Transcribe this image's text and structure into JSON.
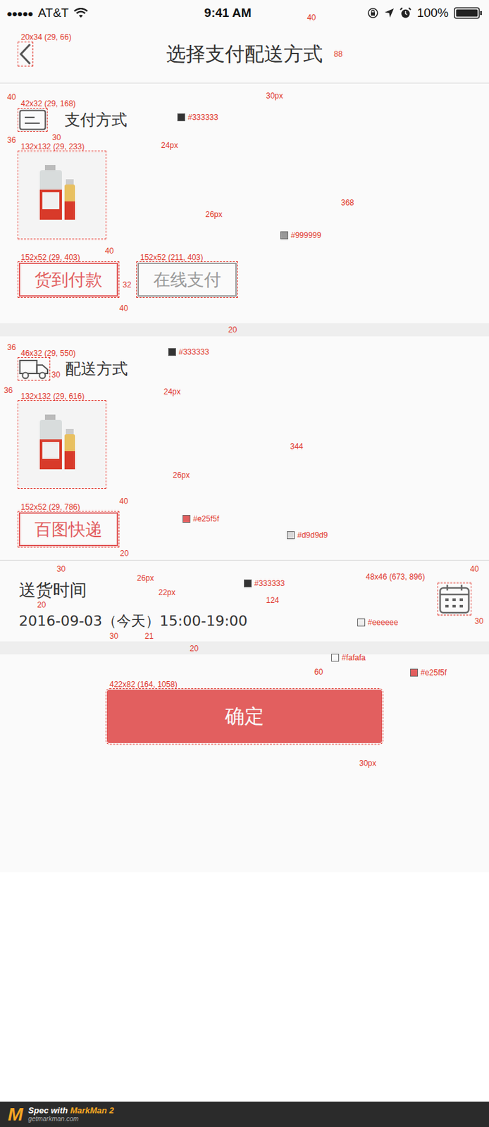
{
  "status_bar": {
    "signal": "●●●●●",
    "carrier": "AT&T",
    "time": "9:41 AM",
    "battery": "100%"
  },
  "nav": {
    "title": "选择支付配送方式"
  },
  "payment": {
    "title": "支付方式",
    "options": [
      {
        "label": "货到付款",
        "selected": true
      },
      {
        "label": "在线支付",
        "selected": false
      }
    ]
  },
  "delivery": {
    "title": "配送方式",
    "options": [
      {
        "label": "百图快递",
        "selected": true
      }
    ]
  },
  "delivery_time": {
    "title": "送货时间",
    "value": "2016-09-03（今天）15:00-19:00"
  },
  "confirm_button": "确定",
  "annotations": [
    {
      "text": "40",
      "kind": "measure"
    },
    {
      "text": "20x34 (29, 66)",
      "kind": "measure"
    },
    {
      "text": "88",
      "kind": "measure"
    },
    {
      "text": "30px",
      "kind": "measure"
    },
    {
      "text": "40",
      "kind": "measure"
    },
    {
      "text": "42x32 (29, 168)",
      "kind": "measure"
    },
    {
      "text": "#333333",
      "kind": "color",
      "color": "#333333"
    },
    {
      "text": "30",
      "kind": "measure"
    },
    {
      "text": "36",
      "kind": "measure"
    },
    {
      "text": "24px",
      "kind": "measure"
    },
    {
      "text": "132x132 (29, 233)",
      "kind": "measure"
    },
    {
      "text": "368",
      "kind": "measure"
    },
    {
      "text": "26px",
      "kind": "measure"
    },
    {
      "text": "#999999",
      "kind": "color",
      "color": "#999999"
    },
    {
      "text": "40",
      "kind": "measure"
    },
    {
      "text": "152x52 (29, 403)",
      "kind": "measure"
    },
    {
      "text": "152x52 (211, 403)",
      "kind": "measure"
    },
    {
      "text": "32",
      "kind": "measure"
    },
    {
      "text": "40",
      "kind": "measure"
    },
    {
      "text": "20",
      "kind": "measure"
    },
    {
      "text": "36",
      "kind": "measure"
    },
    {
      "text": "46x32 (29, 550)",
      "kind": "measure"
    },
    {
      "text": "#333333",
      "kind": "color",
      "color": "#333333"
    },
    {
      "text": "30",
      "kind": "measure"
    },
    {
      "text": "24px",
      "kind": "measure"
    },
    {
      "text": "36",
      "kind": "measure"
    },
    {
      "text": "132x132 (29, 616)",
      "kind": "measure"
    },
    {
      "text": "344",
      "kind": "measure"
    },
    {
      "text": "26px",
      "kind": "measure"
    },
    {
      "text": "40",
      "kind": "measure"
    },
    {
      "text": "152x52 (29, 786)",
      "kind": "measure"
    },
    {
      "text": "#e25f5f",
      "kind": "color",
      "color": "#e25f5f"
    },
    {
      "text": "#d9d9d9",
      "kind": "color",
      "color": "#d9d9d9"
    },
    {
      "text": "20",
      "kind": "measure"
    },
    {
      "text": "30",
      "kind": "measure"
    },
    {
      "text": "48x46 (673, 896)",
      "kind": "measure"
    },
    {
      "text": "40",
      "kind": "measure"
    },
    {
      "text": "26px",
      "kind": "measure"
    },
    {
      "text": "#333333",
      "kind": "color",
      "color": "#333333"
    },
    {
      "text": "22px",
      "kind": "measure"
    },
    {
      "text": "124",
      "kind": "measure"
    },
    {
      "text": "20",
      "kind": "measure"
    },
    {
      "text": "21",
      "kind": "measure"
    },
    {
      "text": "30",
      "kind": "measure"
    },
    {
      "text": "30",
      "kind": "measure"
    },
    {
      "text": "#eeeeee",
      "kind": "color",
      "color": "#eeeeee"
    },
    {
      "text": "20",
      "kind": "measure"
    },
    {
      "text": "#fafafa",
      "kind": "color",
      "color": "#fafafa"
    },
    {
      "text": "60",
      "kind": "measure"
    },
    {
      "text": "#e25f5f",
      "kind": "color",
      "color": "#e25f5f"
    },
    {
      "text": "422x82 (164, 1058)",
      "kind": "measure"
    },
    {
      "text": "30px",
      "kind": "measure"
    }
  ],
  "footer": {
    "logo": "M",
    "label": "Spec with",
    "product": "MarkMan 2",
    "url": "getmarkman.com"
  }
}
